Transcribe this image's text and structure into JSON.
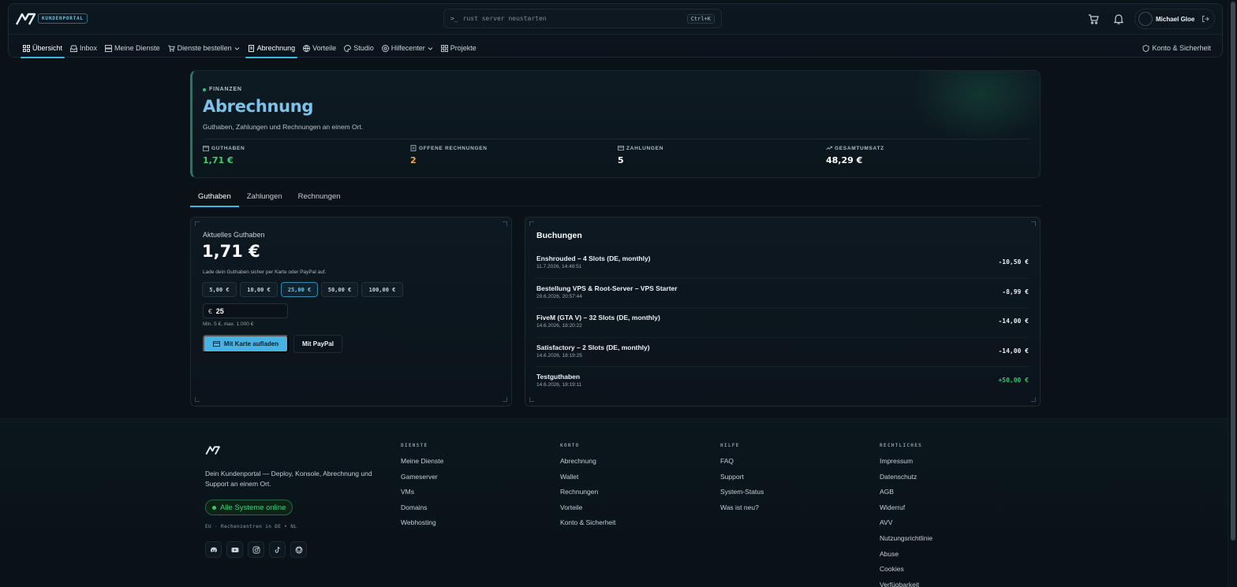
{
  "header": {
    "badge": "KUNDENPORTAL",
    "command": {
      "prompt": ">_",
      "placeholder": "rust server neustarten",
      "shortcut": "Ctrl+K"
    },
    "user": {
      "name": "Michael Gloe"
    }
  },
  "nav": {
    "items": [
      {
        "label": "Übersicht",
        "icon": "grid-icon",
        "active": true
      },
      {
        "label": "Inbox",
        "icon": "inbox-icon"
      },
      {
        "label": "Meine Dienste",
        "icon": "server-icon"
      },
      {
        "label": "Dienste bestellen",
        "icon": "cart-icon",
        "dropdown": true
      },
      {
        "label": "Abrechnung",
        "icon": "receipt-icon",
        "active": true
      },
      {
        "label": "Vorteile",
        "icon": "globe-icon"
      },
      {
        "label": "Studio",
        "icon": "palette-icon"
      },
      {
        "label": "Hilfecenter",
        "icon": "lifebuoy-icon",
        "dropdown": true
      },
      {
        "label": "Projekte",
        "icon": "folders-icon"
      }
    ],
    "right": {
      "label": "Konto & Sicherheit",
      "icon": "shield-icon"
    }
  },
  "hero": {
    "eyebrow": "FINANZEN",
    "title": "Abrechnung",
    "subtitle": "Guthaben, Zahlungen und Rechnungen an einem Ort.",
    "stats": [
      {
        "label": "GUTHABEN",
        "value": "1,71 €",
        "color": "#3ecf6e",
        "icon": "wallet-icon"
      },
      {
        "label": "OFFENE RECHNUNGEN",
        "value": "2",
        "color": "#f0a93b",
        "icon": "invoice-icon"
      },
      {
        "label": "ZAHLUNGEN",
        "value": "5",
        "color": "#ffffff",
        "icon": "card-icon"
      },
      {
        "label": "GESAMTUMSATZ",
        "value": "48,29 €",
        "color": "#ffffff",
        "icon": "trend-up-icon"
      }
    ]
  },
  "tabs": [
    {
      "label": "Guthaben",
      "active": true
    },
    {
      "label": "Zahlungen"
    },
    {
      "label": "Rechnungen"
    }
  ],
  "balance": {
    "label": "Aktuelles Guthaben",
    "amount": "1,71 €",
    "hint": "Lade dein Guthaben sicher per Karte oder PayPal auf.",
    "chips": [
      "5,00 €",
      "10,00 €",
      "25,00 €",
      "50,00 €",
      "100,00 €"
    ],
    "selected_chip": 2,
    "currency": "€",
    "input_value": "25",
    "minmax": "Min. 5 €, max. 1.000 €",
    "card_button": "Mit Karte aufladen",
    "paypal_button": "Mit PayPal"
  },
  "bookings": {
    "title": "Buchungen",
    "rows": [
      {
        "name": "Enshrouded – 4 Slots (DE, monthly)",
        "date": "11.7.2026, 14:48:51",
        "amount": "-10,50 €",
        "positive": false
      },
      {
        "name": "Bestellung VPS & Root-Server – VPS Starter",
        "date": "29.6.2026, 20:57:44",
        "amount": "-8,99 €",
        "positive": false
      },
      {
        "name": "FiveM (GTA V) – 32 Slots (DE, monthly)",
        "date": "14.6.2026, 18:20:22",
        "amount": "-14,00 €",
        "positive": false
      },
      {
        "name": "Satisfactory – 2 Slots (DE, monthly)",
        "date": "14.6.2026, 18:19:25",
        "amount": "-14,00 €",
        "positive": false
      },
      {
        "name": "Testguthaben",
        "date": "14.6.2026, 18:19:11",
        "amount": "+50,00 €",
        "positive": true
      }
    ]
  },
  "footer": {
    "description": "Dein Kundenportal — Deploy, Konsole, Abrechnung und Support an einem Ort.",
    "status": "Alle Systeme online",
    "datacenters": "EU · Rechenzentren in DE • NL",
    "socials": [
      "discord-icon",
      "youtube-icon",
      "instagram-icon",
      "tiktok-icon",
      "github-icon"
    ],
    "columns": [
      {
        "heading": "DIENSTE",
        "links": [
          "Meine Dienste",
          "Gameserver",
          "VMs",
          "Domains",
          "Webhosting"
        ]
      },
      {
        "heading": "KONTO",
        "links": [
          "Abrechnung",
          "Wallet",
          "Rechnungen",
          "Vorteile",
          "Konto & Sicherheit"
        ]
      },
      {
        "heading": "HILFE",
        "links": [
          "FAQ",
          "Support",
          "System-Status",
          "Was ist neu?"
        ]
      },
      {
        "heading": "RECHTLICHES",
        "links": [
          "Impressum",
          "Datenschutz",
          "AGB",
          "Widerruf",
          "AVV",
          "Nutzungsrichtlinie",
          "Abuse",
          "Cookies",
          "Verfügbarkeit"
        ]
      }
    ]
  },
  "colors": {
    "accent": "#47b3e3",
    "success": "#36c46f",
    "warning": "#f0a93b",
    "background": "#0a1117"
  }
}
